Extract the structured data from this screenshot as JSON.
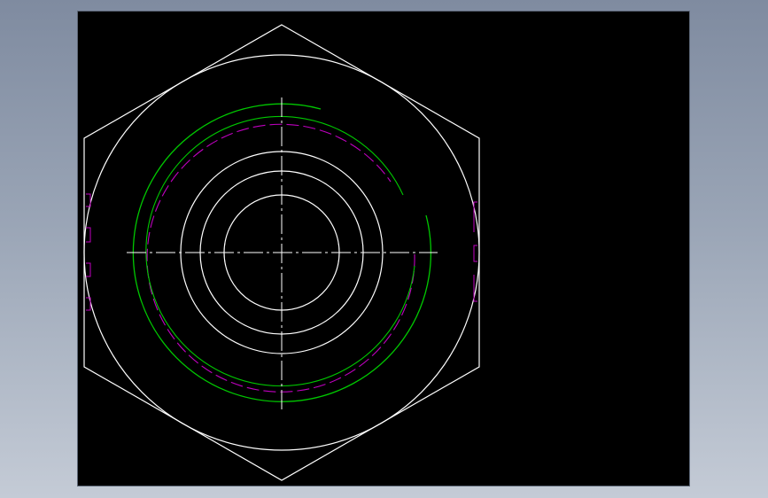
{
  "colors": {
    "background": "#8e99ab",
    "viewport": "#000000",
    "geometry": "#ffffff",
    "thread_line": "#00c800",
    "hidden_thread": "#c000c0"
  },
  "drawing": {
    "view": "hex-nut-top-view"
  }
}
